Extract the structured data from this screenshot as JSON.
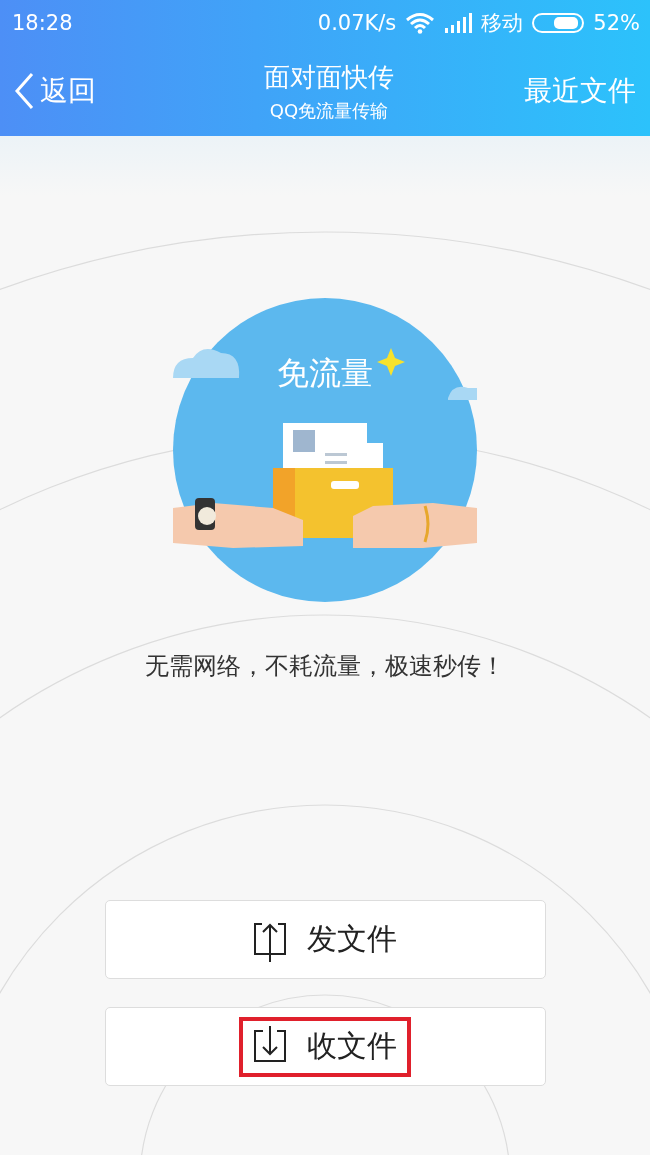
{
  "status_bar": {
    "time": "18:28",
    "speed": "0.07K/s",
    "carrier": "移动",
    "battery": "52%"
  },
  "nav_bar": {
    "back": "返回",
    "title": "面对面快传",
    "subtitle": "QQ免流量传输",
    "action": "最近文件"
  },
  "illustration": {
    "caption": "免流量"
  },
  "tagline": "无需网络，不耗流量，极速秒传！",
  "buttons": [
    {
      "kind": "send",
      "label": "发文件",
      "highlighted": false
    },
    {
      "kind": "receive",
      "label": "收文件",
      "highlighted": true
    }
  ]
}
